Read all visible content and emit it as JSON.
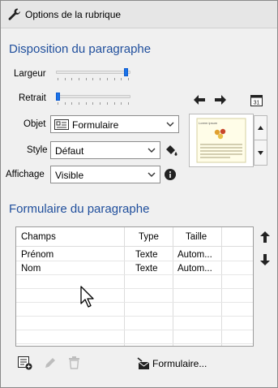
{
  "header": {
    "title": "Options de la rubrique",
    "icon": "wrench-icon"
  },
  "layout_section": {
    "title": "Disposition du paragraphe",
    "width_label": "Largeur",
    "width_value": 0.97,
    "indent_label": "Retrait",
    "indent_value": 0.0,
    "object_label": "Objet",
    "object_value": "Formulaire",
    "style_label": "Style",
    "style_value": "Défaut",
    "display_label": "Affichage",
    "display_value": "Visible",
    "calendar_day": "31",
    "preview_title": "Lorem ipsum"
  },
  "form_section": {
    "title": "Formulaire du paragraphe",
    "columns": [
      "Champs",
      "Type",
      "Taille"
    ],
    "rows": [
      [
        "Prénom",
        "Texte",
        "Autom..."
      ],
      [
        "Nom",
        "Texte",
        "Autom..."
      ]
    ],
    "form_button_label": "Formulaire..."
  },
  "colors": {
    "accent": "#1f4e9c",
    "slider": "#1a73e8"
  }
}
